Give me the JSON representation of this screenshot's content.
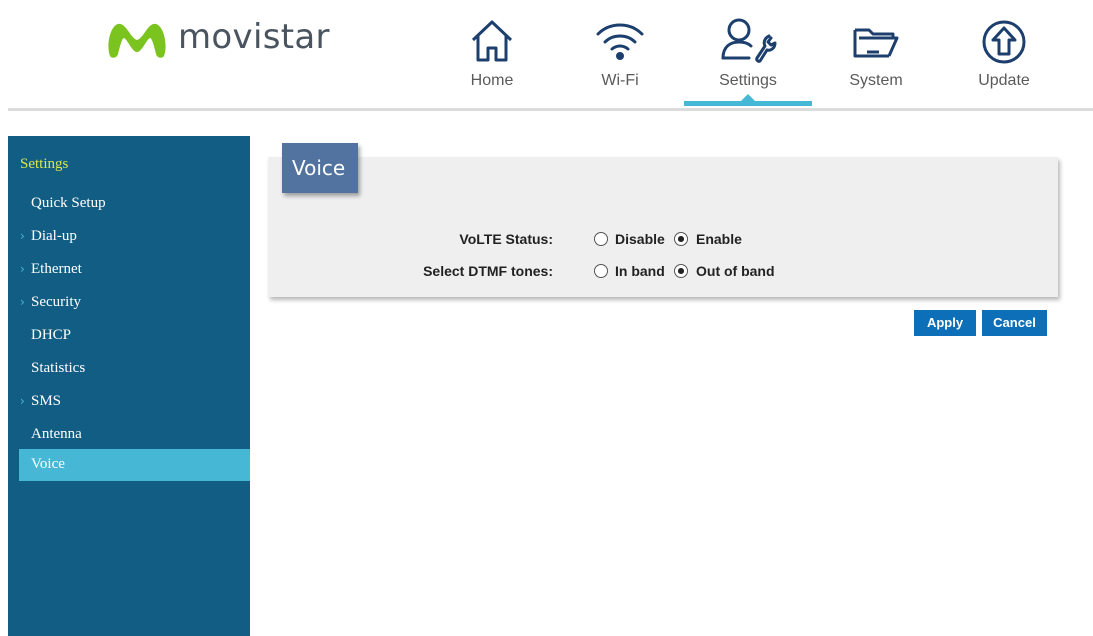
{
  "brand": {
    "name": "movistar",
    "logo_icon": "movistar-m-logo",
    "logo_color": "#7bc41f"
  },
  "topnav": {
    "items": [
      {
        "label": "Home",
        "icon": "home-icon",
        "active": false
      },
      {
        "label": "Wi-Fi",
        "icon": "wifi-icon",
        "active": false
      },
      {
        "label": "Settings",
        "icon": "user-wrench-icon",
        "active": true
      },
      {
        "label": "System",
        "icon": "folder-icon",
        "active": false
      },
      {
        "label": "Update",
        "icon": "upload-arrow-icon",
        "active": false
      }
    ],
    "icon_color": "#1c3f6e",
    "active_color": "#47b7d6"
  },
  "sidebar": {
    "title": "Settings",
    "items": [
      {
        "label": "Quick Setup",
        "expandable": false,
        "active": false
      },
      {
        "label": "Dial-up",
        "expandable": true,
        "active": false
      },
      {
        "label": "Ethernet",
        "expandable": true,
        "active": false
      },
      {
        "label": "Security",
        "expandable": true,
        "active": false
      },
      {
        "label": "DHCP",
        "expandable": false,
        "active": false
      },
      {
        "label": "Statistics",
        "expandable": false,
        "active": false
      },
      {
        "label": "SMS",
        "expandable": true,
        "active": false
      },
      {
        "label": "Antenna",
        "expandable": false,
        "active": false
      },
      {
        "label": "Voice",
        "expandable": false,
        "active": true
      }
    ],
    "background": "#125d84",
    "active_background": "#47b7d6",
    "title_color": "#d9e84a"
  },
  "panel": {
    "title": "Voice",
    "rows": [
      {
        "label": "VoLTE Status:",
        "options": [
          {
            "label": "Disable",
            "checked": false
          },
          {
            "label": "Enable",
            "checked": true
          }
        ]
      },
      {
        "label": "Select DTMF tones:",
        "options": [
          {
            "label": "In band",
            "checked": false
          },
          {
            "label": "Out of band",
            "checked": true
          }
        ]
      }
    ]
  },
  "buttons": {
    "apply": "Apply",
    "cancel": "Cancel",
    "color": "#0d6fb7"
  }
}
